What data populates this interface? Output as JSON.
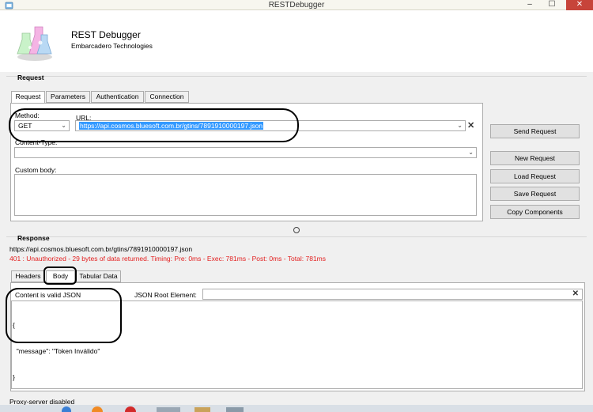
{
  "window": {
    "title": "RESTDebugger",
    "minimize": "–",
    "maximize": "☐",
    "close": "✕"
  },
  "header": {
    "app_name": "REST Debugger",
    "company": "Embarcadero Technologies"
  },
  "request": {
    "section_label": "Request",
    "tabs": [
      "Request",
      "Parameters",
      "Authentication",
      "Connection"
    ],
    "method_label": "Method:",
    "method_value": "GET",
    "url_label": "URL:",
    "url_value": "https://api.cosmos.bluesoft.com.br/gtins/7891910000197.json",
    "clear_icon": "✕",
    "content_type_label": "Content-Type:",
    "content_type_value": "",
    "custom_body_label": "Custom body:",
    "custom_body_value": ""
  },
  "actions": {
    "send": "Send Request",
    "new": "New Request",
    "load": "Load Request",
    "save": "Save Request",
    "copy": "Copy Components"
  },
  "response": {
    "section_label": "Response",
    "url": "https://api.cosmos.bluesoft.com.br/gtins/7891910000197.json",
    "status_line": "401 : Unauthorized - 29 bytes of data returned. Timing: Pre: 0ms - Exec: 781ms - Post: 0ms - Total: 781ms",
    "tabs": [
      "Headers",
      "Body",
      "Tabular Data"
    ],
    "valid_label": "Content is valid JSON",
    "root_label": "JSON Root Element:",
    "root_value": "",
    "json_lines": [
      "{",
      "  \"message\": \"Token Inválido\"",
      "}"
    ]
  },
  "status_bar": {
    "text": "Proxy-server disabled"
  },
  "colors": {
    "accent_selection": "#3399ff",
    "status_error": "#e32020",
    "close_button": "#c7443a"
  }
}
